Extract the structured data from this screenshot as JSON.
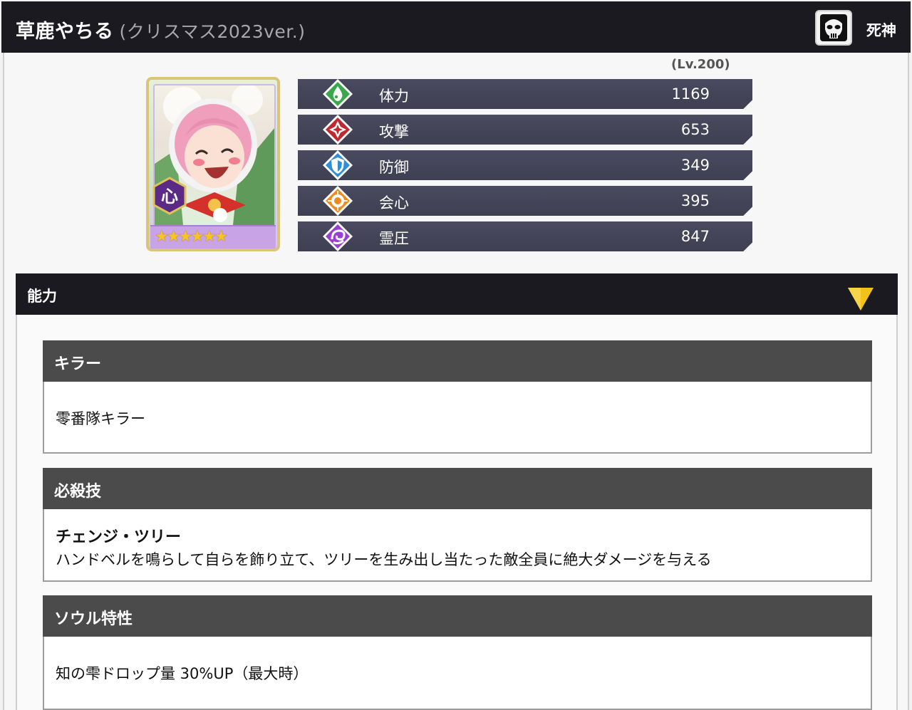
{
  "header": {
    "name": "草鹿やちる",
    "version": "(クリスマス2023ver.)",
    "faction_icon": "skull-mask-icon",
    "faction_label": "死神"
  },
  "card": {
    "attribute_icon": "kokoro-hexagon-icon",
    "attribute_text": "心",
    "rarity_stars": 6,
    "star_glyphs": "★★★★★★"
  },
  "level": "(Lv.200)",
  "stats": [
    {
      "label": "体力",
      "value": "1169",
      "icon": "hp-drop-icon",
      "color": "#39a84a"
    },
    {
      "label": "攻撃",
      "value": "653",
      "icon": "attack-icon",
      "color": "#c2282f"
    },
    {
      "label": "防御",
      "value": "349",
      "icon": "defense-shield-icon",
      "color": "#2f8fd6"
    },
    {
      "label": "会心",
      "value": "395",
      "icon": "critical-icon",
      "color": "#f08a1c"
    },
    {
      "label": "霊圧",
      "value": "847",
      "icon": "spirit-pressure-icon",
      "color": "#9a3fd0"
    }
  ],
  "ability": {
    "title": "能力",
    "toggle_icon": "collapse-triangle-icon",
    "sections": [
      {
        "heading": "キラー",
        "text": "零番隊キラー"
      },
      {
        "heading": "必殺技",
        "name": "チェンジ・ツリー",
        "text": "ハンドベルを鳴らして自らを飾り立て、ツリーを生み出し当たった敵全員に絶大ダメージを与える"
      },
      {
        "heading": "ソウル特性",
        "text": "知の雫ドロップ量 30%UP（最大時）"
      }
    ]
  }
}
